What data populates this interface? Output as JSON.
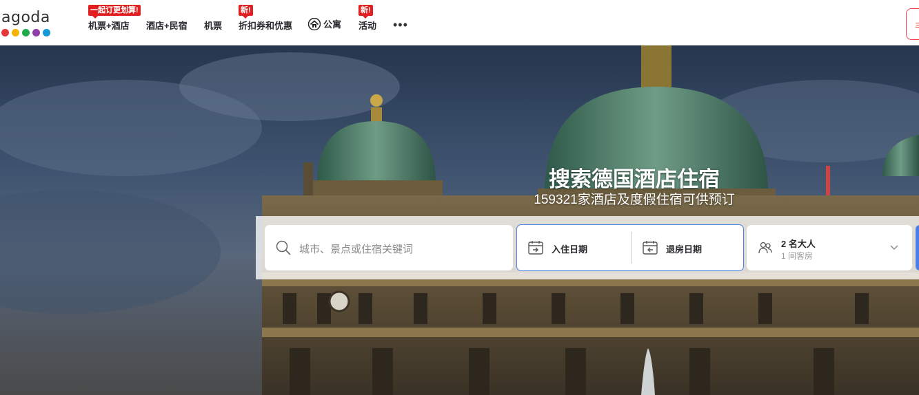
{
  "logo": {
    "text": "agoda",
    "dots": [
      "#e5383b",
      "#f5b400",
      "#1faa4b",
      "#8e3fa8",
      "#1499d6"
    ]
  },
  "nav": {
    "items": [
      {
        "label": "机票+酒店",
        "badge": "一起订更划算!"
      },
      {
        "label": "酒店+民宿",
        "badge": ""
      },
      {
        "label": "机票",
        "badge": ""
      },
      {
        "label": "折扣券和优惠",
        "badge": "新!"
      },
      {
        "label": "公寓",
        "badge": ""
      },
      {
        "label": "活动",
        "badge": "新!"
      }
    ],
    "more": "•••",
    "right_cut_text": "丰"
  },
  "hero": {
    "title": "搜索德国酒店住宿",
    "subtitle": "159321家酒店及度假住宿可供预订"
  },
  "search": {
    "destination_placeholder": "城市、景点或住宿关键词",
    "checkin_label": "入住日期",
    "checkout_label": "退房日期",
    "guests_line1": "2 名大人",
    "guests_line2": "1 间客房"
  },
  "colors": {
    "accent": "#4a7ee6",
    "badge": "#e02020"
  }
}
